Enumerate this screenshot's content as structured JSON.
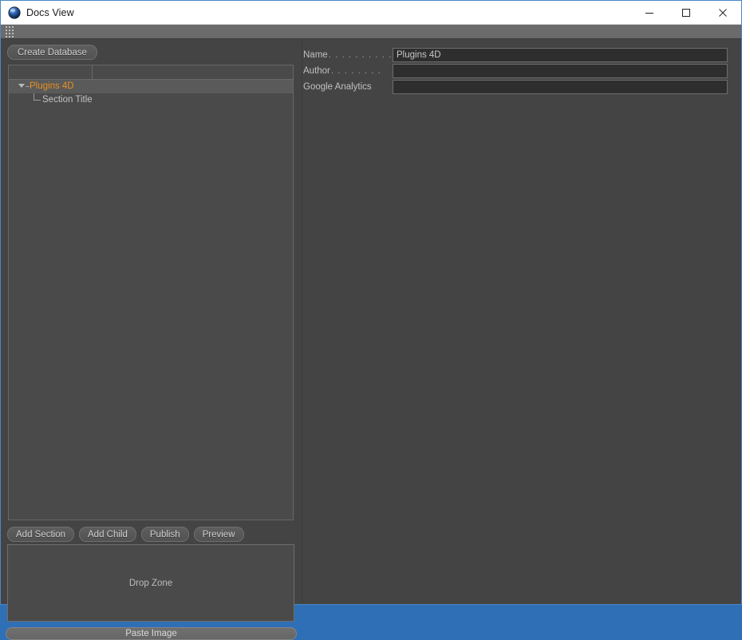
{
  "window": {
    "title": "Docs View",
    "icon": "app-sphere-icon",
    "controls": {
      "minimize": "—",
      "maximize": "□",
      "close": "✕"
    },
    "border_color": "#4a87c9",
    "titlebar_bg": "#ffffff",
    "client_bg": "#444444"
  },
  "toolbar": {
    "grip": "grip-dots-icon"
  },
  "left_panel": {
    "create_database_label": "Create Database",
    "tree": {
      "columns": [
        "",
        ""
      ],
      "rows": [
        {
          "id": "root",
          "label": "Plugins 4D",
          "depth": 0,
          "selected": true,
          "expanded": true,
          "color": "#e8901f"
        },
        {
          "id": "child",
          "label": "Section Title",
          "depth": 1,
          "selected": false,
          "expanded": false,
          "color": "#c4c4c4"
        }
      ]
    },
    "actions": [
      {
        "id": "add-section",
        "label": "Add Section"
      },
      {
        "id": "add-child",
        "label": "Add Child"
      },
      {
        "id": "publish",
        "label": "Publish"
      },
      {
        "id": "preview",
        "label": "Preview"
      }
    ],
    "dropzone_label": "Drop Zone",
    "paste_image_label": "Paste Image"
  },
  "right_panel": {
    "fields": [
      {
        "id": "name",
        "label": "Name",
        "leader": ". . . . . . . . . .",
        "value": "Plugins 4D",
        "placeholder": ""
      },
      {
        "id": "author",
        "label": "Author",
        "leader": ". . . . . . . .",
        "value": "",
        "placeholder": ""
      },
      {
        "id": "analytics",
        "label": "Google Analytics",
        "leader": "",
        "value": "",
        "placeholder": ""
      }
    ]
  }
}
